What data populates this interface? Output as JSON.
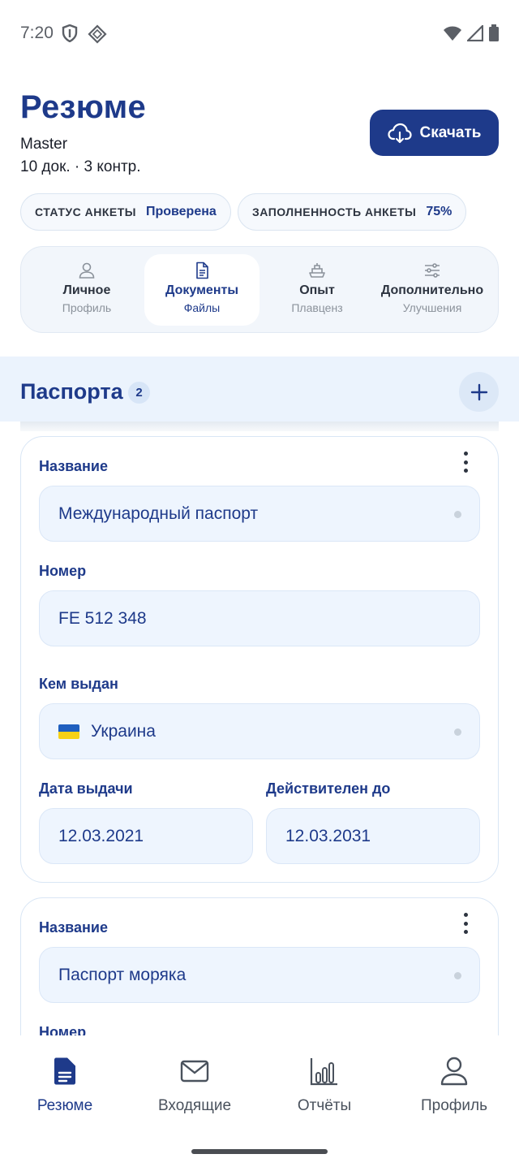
{
  "status_bar": {
    "time": "7:20"
  },
  "header": {
    "title": "Резюме",
    "subtitle": "Master",
    "meta": "10 док. · 3 контр.",
    "download_label": "Скачать"
  },
  "chips": [
    {
      "label": "СТАТУС АНКЕТЫ",
      "value": "Проверена"
    },
    {
      "label": "ЗАПОЛНЕННОСТЬ АНКЕТЫ",
      "value": "75%"
    }
  ],
  "tabs": [
    {
      "title": "Личное",
      "subtitle": "Профиль",
      "icon": "person-icon"
    },
    {
      "title": "Документы",
      "subtitle": "Файлы",
      "icon": "document-icon",
      "active": true
    },
    {
      "title": "Опыт",
      "subtitle": "Плавценз",
      "icon": "ship-icon"
    },
    {
      "title": "Дополнительно",
      "subtitle": "Улучшения",
      "icon": "sliders-icon"
    }
  ],
  "section": {
    "title": "Паспорта",
    "count": "2"
  },
  "cards": [
    {
      "name_label": "Название",
      "name_value": "Международный паспорт",
      "number_label": "Номер",
      "number_value": "FE 512 348",
      "issuer_label": "Кем выдан",
      "issuer_value": "Украина",
      "issue_date_label": "Дата выдачи",
      "issue_date_value": "12.03.2021",
      "valid_until_label": "Действителен до",
      "valid_until_value": "12.03.2031"
    },
    {
      "name_label": "Название",
      "name_value": "Паспорт моряка",
      "number_label": "Номер"
    }
  ],
  "bottom_nav": [
    {
      "label": "Резюме",
      "icon": "document-filled-icon",
      "active": true
    },
    {
      "label": "Входящие",
      "icon": "mail-icon"
    },
    {
      "label": "Отчёты",
      "icon": "bar-chart-icon"
    },
    {
      "label": "Профиль",
      "icon": "person-icon"
    }
  ],
  "colors": {
    "primary": "#1e3a8a",
    "field_bg": "#eef5fe",
    "band_bg": "#ebf3fd"
  }
}
